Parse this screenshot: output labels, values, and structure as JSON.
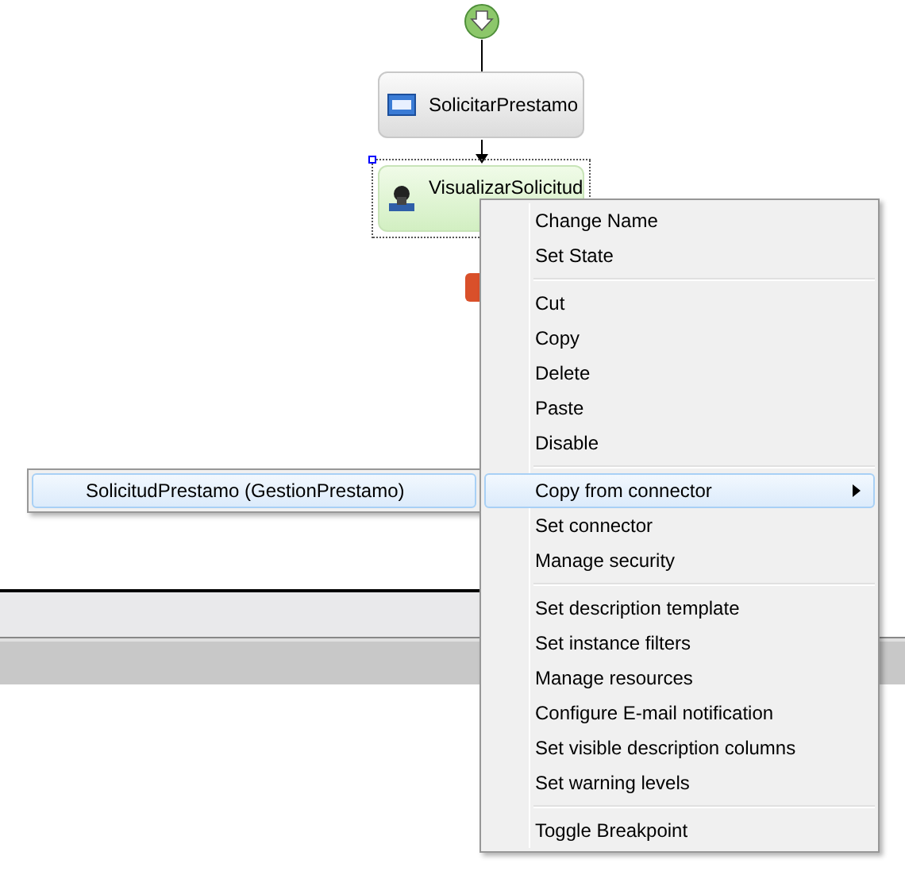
{
  "diagram": {
    "nodes": [
      {
        "label": "SolicitarPrestamo",
        "kind": "form",
        "selected": false
      },
      {
        "label": "VisualizarSolicitud",
        "kind": "person",
        "selected": true
      }
    ]
  },
  "context_menu": {
    "items": [
      {
        "kind": "item",
        "label": "Change Name",
        "has_submenu": false,
        "selected": false
      },
      {
        "kind": "item",
        "label": "Set State",
        "has_submenu": false,
        "selected": false
      },
      {
        "kind": "separator"
      },
      {
        "kind": "item",
        "label": "Cut",
        "has_submenu": false,
        "selected": false
      },
      {
        "kind": "item",
        "label": "Copy",
        "has_submenu": false,
        "selected": false
      },
      {
        "kind": "item",
        "label": "Delete",
        "has_submenu": false,
        "selected": false
      },
      {
        "kind": "item",
        "label": "Paste",
        "has_submenu": false,
        "selected": false
      },
      {
        "kind": "item",
        "label": "Disable",
        "has_submenu": false,
        "selected": false
      },
      {
        "kind": "separator"
      },
      {
        "kind": "item",
        "label": "Copy from connector",
        "has_submenu": true,
        "selected": true
      },
      {
        "kind": "item",
        "label": "Set connector",
        "has_submenu": false,
        "selected": false
      },
      {
        "kind": "item",
        "label": "Manage security",
        "has_submenu": false,
        "selected": false
      },
      {
        "kind": "separator"
      },
      {
        "kind": "item",
        "label": "Set description template",
        "has_submenu": false,
        "selected": false
      },
      {
        "kind": "item",
        "label": "Set instance filters",
        "has_submenu": false,
        "selected": false
      },
      {
        "kind": "item",
        "label": "Manage resources",
        "has_submenu": false,
        "selected": false
      },
      {
        "kind": "item",
        "label": "Configure E-mail notification",
        "has_submenu": false,
        "selected": false
      },
      {
        "kind": "item",
        "label": "Set visible description columns",
        "has_submenu": false,
        "selected": false
      },
      {
        "kind": "item",
        "label": "Set warning levels",
        "has_submenu": false,
        "selected": false
      },
      {
        "kind": "separator"
      },
      {
        "kind": "item",
        "label": "Toggle Breakpoint",
        "has_submenu": false,
        "selected": false
      }
    ]
  },
  "submenu": {
    "items": [
      {
        "label": "SolicitudPrestamo (GestionPrestamo)",
        "selected": true
      }
    ]
  }
}
